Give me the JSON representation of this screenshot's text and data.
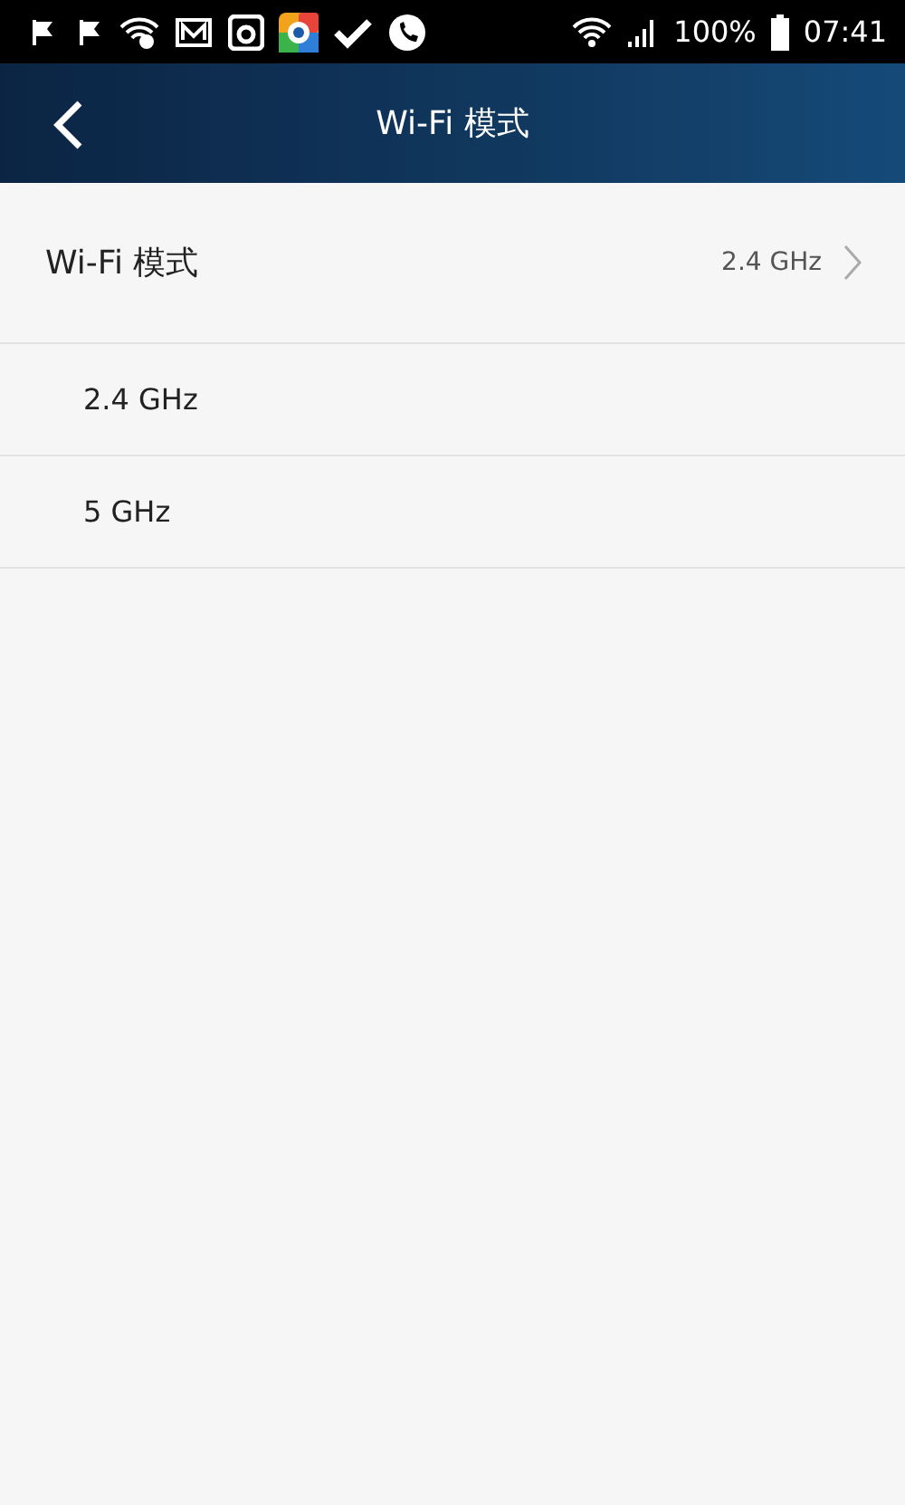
{
  "status_bar": {
    "battery": "100%",
    "time": "07:41"
  },
  "header": {
    "title": "Wi-Fi 模式"
  },
  "setting": {
    "label": "Wi-Fi 模式",
    "value": "2.4 GHz"
  },
  "options": [
    {
      "label": "2.4 GHz"
    },
    {
      "label": "5 GHz"
    }
  ]
}
